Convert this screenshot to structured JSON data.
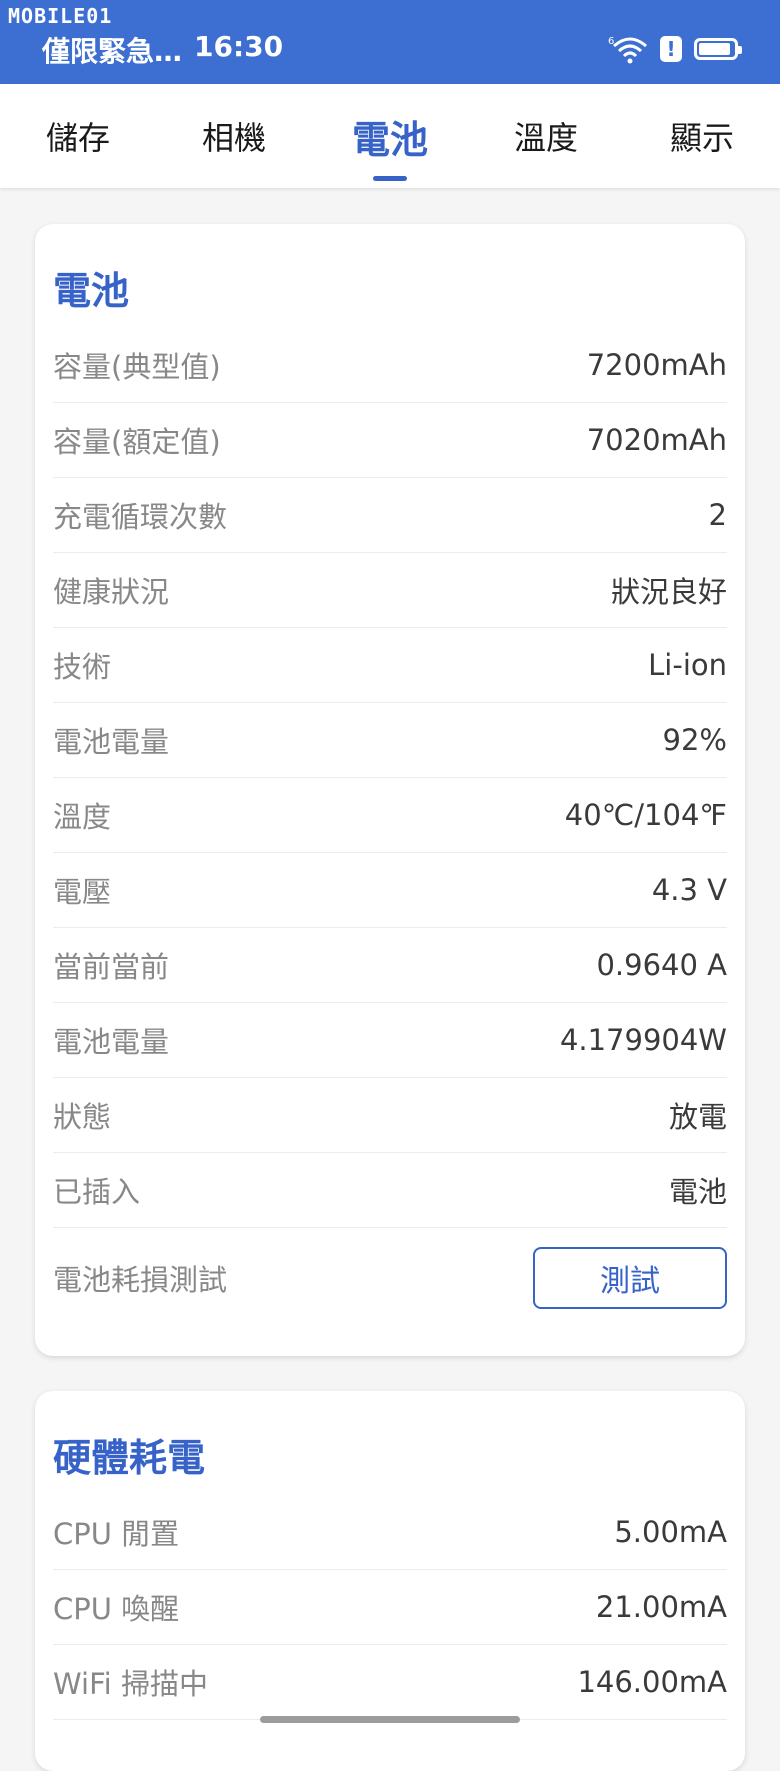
{
  "status_bar": {
    "watermark": "MOBILE01",
    "carrier": "僅限緊急…",
    "time": "16:30",
    "wifi_badge": "6",
    "alert_glyph": "!",
    "battery_level": 0.92,
    "icons": [
      "wifi-icon",
      "alert-icon",
      "battery-icon"
    ]
  },
  "tabs": [
    {
      "label": "儲存",
      "active": false
    },
    {
      "label": "相機",
      "active": false
    },
    {
      "label": "電池",
      "active": true
    },
    {
      "label": "溫度",
      "active": false
    },
    {
      "label": "顯示",
      "active": false
    }
  ],
  "battery_card": {
    "title": "電池",
    "rows": [
      {
        "label": "容量(典型值)",
        "value": "7200mAh"
      },
      {
        "label": "容量(額定值)",
        "value": "7020mAh"
      },
      {
        "label": "充電循環次數",
        "value": "2"
      },
      {
        "label": "健康狀況",
        "value": "狀況良好"
      },
      {
        "label": "技術",
        "value": "Li-ion"
      },
      {
        "label": "電池電量",
        "value": "92%"
      },
      {
        "label": "溫度",
        "value": "40℃/104℉"
      },
      {
        "label": "電壓",
        "value": "4.3 V"
      },
      {
        "label": "當前當前",
        "value": "0.9640 A"
      },
      {
        "label": "電池電量",
        "value": "4.179904W"
      },
      {
        "label": "狀態",
        "value": "放電"
      },
      {
        "label": "已插入",
        "value": "電池"
      }
    ],
    "test_row": {
      "label": "電池耗損測試",
      "button": "測試"
    }
  },
  "hardware_card": {
    "title": "硬體耗電",
    "rows": [
      {
        "label": "CPU 閒置",
        "value": "5.00mA"
      },
      {
        "label": "CPU 喚醒",
        "value": "21.00mA"
      },
      {
        "label": "WiFi 掃描中",
        "value": "146.00mA"
      }
    ]
  },
  "colors": {
    "accent": "#3763c9",
    "status_bar": "#3c6fd1",
    "label_gray": "#888888",
    "value_dark": "#3a3a3a",
    "background": "#f5f5f5"
  }
}
